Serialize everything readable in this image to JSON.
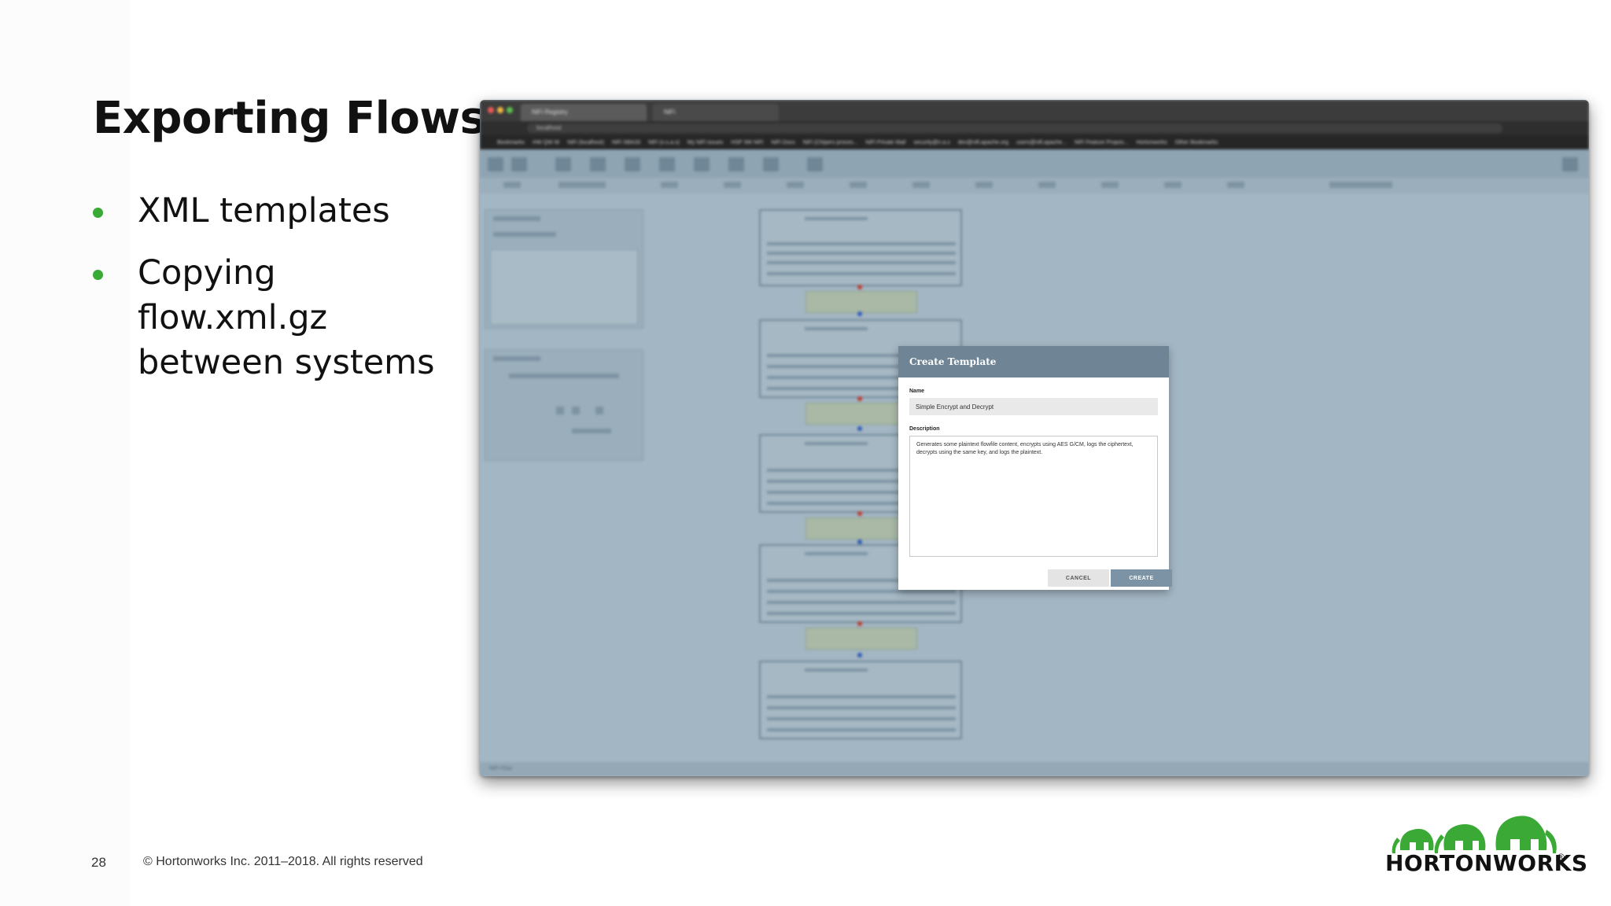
{
  "slide": {
    "title": "Exporting Flows",
    "bullets": [
      "XML templates",
      "Copying flow.xml.gz between systems"
    ],
    "page_number": "28",
    "copyright": "© Hortonworks Inc. 2011–2018. All rights reserved",
    "logo_text": "HORTONWORKS",
    "logo_mark": "®"
  },
  "colors": {
    "bullet": "#3aa935",
    "logo_green": "#3aa935",
    "dialog_header": "#6f8595",
    "canvas": "#a3b6c3"
  },
  "browser": {
    "tabs": [
      "NiFi Registry",
      "NiFi"
    ],
    "address": "localhost",
    "bookmarks": [
      "Bookmarks",
      "HW QW W",
      "NiFi (localhost)",
      "NiFi SBA33",
      "NiFi (n.s.a.s)",
      "My NiFi issues",
      "HSP 3W NiFi",
      "NiFi Docs",
      "NiFi (Chipers proces...",
      "NiFi Private Mail",
      "security@n.a.s",
      "dev@nifi.apache.org",
      "users@nifi.apache...",
      "NiFi Feature Propos...",
      "Hortonworks",
      "Other Bookmarks"
    ]
  },
  "nifi": {
    "processors": [
      "GenerateFlowFile",
      "EncryptContent",
      "LogAttribute",
      "DecryptContent",
      "LogAttribute"
    ],
    "operate_text": "Multiple components selected",
    "bottom_label": "NiFi Flow"
  },
  "dialog": {
    "title": "Create Template",
    "name_label": "Name",
    "name_value": "Simple Encrypt and Decrypt",
    "description_label": "Description",
    "description_value": "Generates some plaintext flowfile content, encrypts using AES G/CM, logs the ciphertext, decrypts using the same key, and logs the plaintext.",
    "cancel_label": "CANCEL",
    "create_label": "CREATE"
  }
}
